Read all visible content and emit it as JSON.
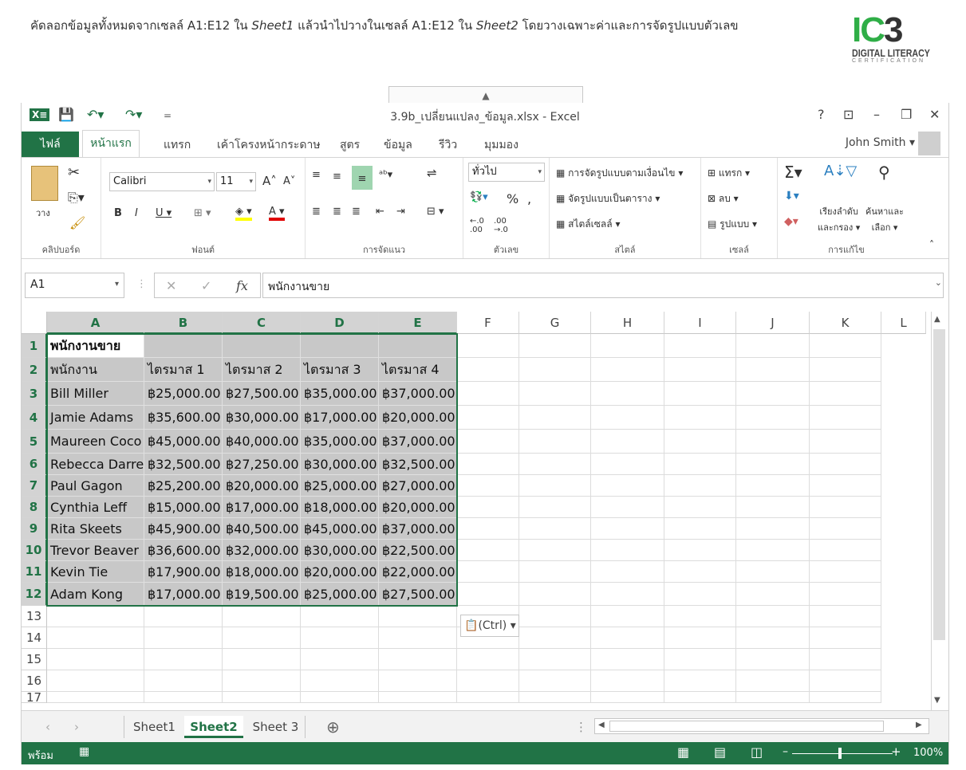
{
  "instruction": {
    "part1": "คัดลอกข้อมูลทั้งหมดจากเซลล์ A1:E12 ใน ",
    "sheet_a": "Sheet1",
    "part2": " แล้วนำไปวางในเซลล์ A1:E12 ใน ",
    "sheet_b": "Sheet2",
    "part3": " โดยวางเฉพาะค่าและการจัดรูปแบบตัวเลข"
  },
  "logo": {
    "ic": "IC",
    "three": "3",
    "line1": "DIGITAL LITERACY",
    "line2": "CERTIFICATION"
  },
  "window": {
    "title": "3.9b_เปลี่ยนแปลง_ข้อมูล.xlsx - Excel"
  },
  "tabs": {
    "file": "ไฟล์",
    "home": "หน้าแรก",
    "insert": "แทรก",
    "layout": "เค้าโครงหน้ากระดาษ",
    "formulas": "สูตร",
    "data": "ข้อมูล",
    "review": "รีวิว",
    "view": "มุมมอง"
  },
  "user": {
    "name": "John Smith"
  },
  "ribbon": {
    "clipboard": {
      "paste": "วาง",
      "label": "คลิปบอร์ด"
    },
    "font": {
      "name": "Calibri",
      "size": "11",
      "label": "ฟอนต์"
    },
    "alignment": {
      "label": "การจัดแนว"
    },
    "number": {
      "format": "ทั่วไป",
      "label": "ตัวเลข"
    },
    "styles": {
      "conditional": "การจัดรูปแบบตามเงื่อนไข",
      "as_table": "จัดรูปแบบเป็นตาราง",
      "cell_styles": "สไตล์เซลล์",
      "label": "สไตล์"
    },
    "cells": {
      "insert": "แทรก",
      "delete": "ลบ",
      "format": "รูปแบบ",
      "label": "เซลล์"
    },
    "editing": {
      "sort": "เรียงลำดับ",
      "sort2": "และกรอง",
      "find": "ค้นหาและ",
      "find2": "เลือก",
      "label": "การแก้ไข"
    }
  },
  "formula_bar": {
    "name_box": "A1",
    "content": "พนักงานขาย"
  },
  "columns": [
    "A",
    "B",
    "C",
    "D",
    "E",
    "F",
    "G",
    "H",
    "I",
    "J",
    "K",
    "L"
  ],
  "rows": [
    "1",
    "2",
    "3",
    "4",
    "5",
    "6",
    "7",
    "8",
    "9",
    "10",
    "11",
    "12",
    "13",
    "14",
    "15",
    "16",
    "17"
  ],
  "cells": [
    [
      "พนักงานขาย",
      "",
      "",
      "",
      ""
    ],
    [
      "พนักงาน",
      "ไตรมาส 1",
      "ไตรมาส 2",
      "ไตรมาส 3",
      "ไตรมาส 4"
    ],
    [
      "Bill Miller",
      "฿25,000.00",
      "฿27,500.00",
      "฿35,000.00",
      "฿37,000.00"
    ],
    [
      "Jamie Adams",
      "฿35,600.00",
      "฿30,000.00",
      "฿17,000.00",
      "฿20,000.00"
    ],
    [
      "Maureen Coco",
      "฿45,000.00",
      "฿40,000.00",
      "฿35,000.00",
      "฿37,000.00"
    ],
    [
      "Rebecca Darrell",
      "฿32,500.00",
      "฿27,250.00",
      "฿30,000.00",
      "฿32,500.00"
    ],
    [
      "Paul Gagon",
      "฿25,200.00",
      "฿20,000.00",
      "฿25,000.00",
      "฿27,000.00"
    ],
    [
      "Cynthia Leff",
      "฿15,000.00",
      "฿17,000.00",
      "฿18,000.00",
      "฿20,000.00"
    ],
    [
      "Rita Skeets",
      "฿45,900.00",
      "฿40,500.00",
      "฿45,000.00",
      "฿37,000.00"
    ],
    [
      "Trevor Beaver",
      "฿36,600.00",
      "฿32,000.00",
      "฿30,000.00",
      "฿22,500.00"
    ],
    [
      "Kevin Tie",
      "฿17,900.00",
      "฿18,000.00",
      "฿20,000.00",
      "฿22,000.00"
    ],
    [
      "Adam Kong",
      "฿17,000.00",
      "฿19,500.00",
      "฿25,000.00",
      "฿27,500.00"
    ]
  ],
  "paste_options": "(Ctrl)",
  "sheets": [
    "Sheet1",
    "Sheet2",
    "Sheet 3"
  ],
  "active_sheet": "Sheet2",
  "status": {
    "ready": "พร้อม",
    "zoom": "100%"
  },
  "colors": {
    "accent": "#217346",
    "selection": "#c8c8c8"
  }
}
